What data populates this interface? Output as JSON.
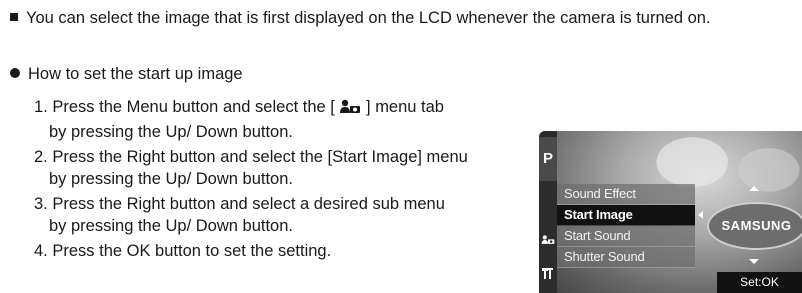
{
  "intro": {
    "text": "You can select the image that is first displayed on the LCD whenever the camera is turned on."
  },
  "how": {
    "heading": "How to set the start up image"
  },
  "steps": [
    {
      "line1a": "1. Press the Menu button and select the [ ",
      "line1b": " ] menu tab",
      "line2": "by pressing the Up/ Down button."
    },
    {
      "line1": "2. Press the Right button and select the [Start Image] menu",
      "line2": "by pressing the Up/ Down button."
    },
    {
      "line1": "3. Press the Right button and select a desired sub menu",
      "line2": "by pressing the Up/ Down button."
    },
    {
      "line1": "4. Press the OK button to set the setting."
    }
  ],
  "lcd": {
    "tab_p": "P",
    "menu": [
      "Sound Effect",
      "Start Image",
      "Start Sound",
      "Shutter Sound"
    ],
    "selected_index": 1,
    "logo": "SAMSUNG",
    "set_label": "Set:OK"
  }
}
